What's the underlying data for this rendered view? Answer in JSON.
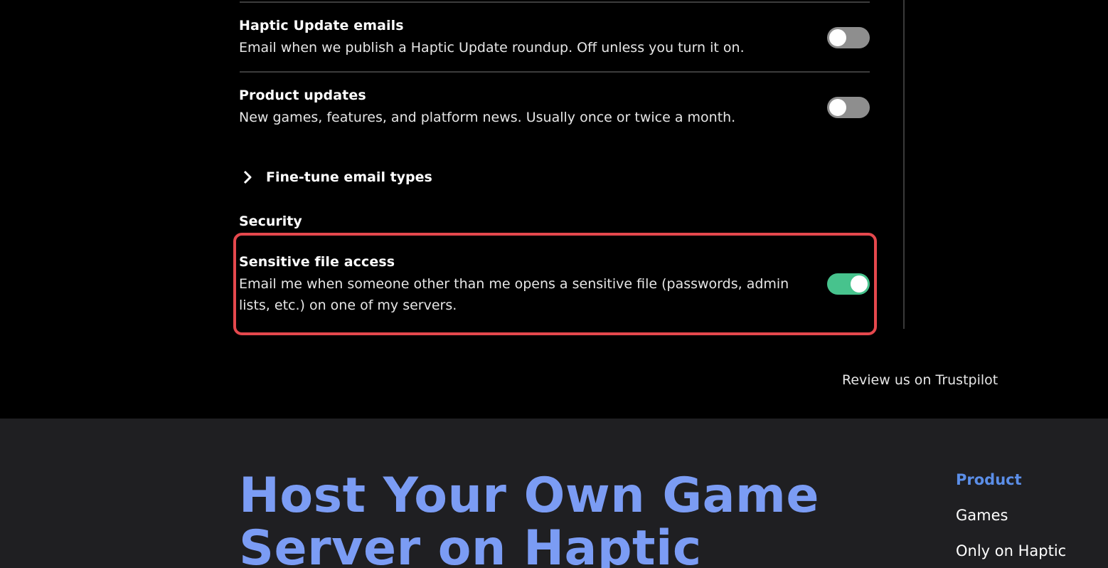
{
  "notifications": {
    "haptic_update": {
      "title": "Haptic Update emails",
      "description": "Email when we publish a Haptic Update roundup. Off unless you turn it on.",
      "enabled": false
    },
    "product_updates": {
      "title": "Product updates",
      "description": "New games, features, and platform news. Usually once or twice a month.",
      "enabled": false
    },
    "fine_tune_label": "Fine-tune email types"
  },
  "security": {
    "heading": "Security",
    "sensitive_file_access": {
      "title": "Sensitive file access",
      "description_line1": "Email me when someone other than me opens a sensitive file (passwords, admin",
      "description_line2": "lists, etc.) on one of my servers.",
      "enabled": true
    }
  },
  "trustpilot_link": "Review us on Trustpilot",
  "footer": {
    "hero_line1": "Host Your Own Game",
    "hero_line2": "Server on Haptic",
    "nav": {
      "heading": "Product",
      "links": [
        "Games",
        "Only on Haptic"
      ]
    }
  },
  "colors": {
    "toggle_on": "#47c38d",
    "toggle_off": "#8e8e8e",
    "highlight": "#e5484d",
    "hero": "#7b9cf4",
    "nav_heading": "#5b8ee8",
    "footer_bg": "#1f1f22"
  },
  "icons": {
    "fine_tune_toggle": "chevron-right-icon"
  }
}
